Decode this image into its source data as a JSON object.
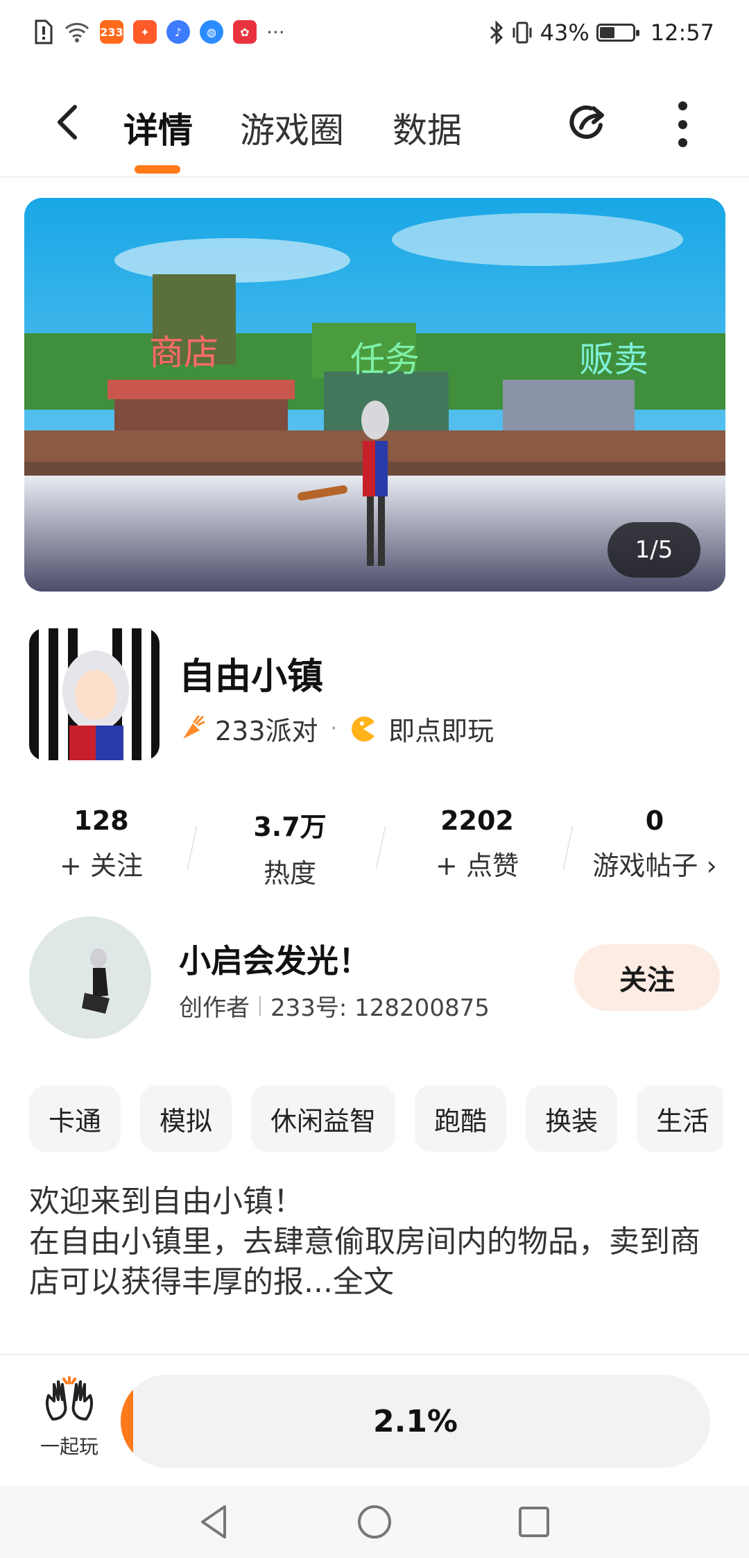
{
  "status_bar": {
    "icons": [
      "alert-icon",
      "wifi-icon",
      "app-233-icon",
      "app-party-icon",
      "music-icon",
      "browser-icon",
      "huawei-icon",
      "more-icon"
    ],
    "app_233": "233",
    "battery": "43%",
    "battery_level": 0.43,
    "time": "12:57"
  },
  "nav": {
    "tabs": [
      "详情",
      "游戏圈",
      "数据"
    ],
    "active_tab": "详情"
  },
  "banner": {
    "counter": "1/5",
    "scene_signs": [
      "商店",
      "任务",
      "贩卖"
    ]
  },
  "game": {
    "title": "自由小镇",
    "platform": "233派对",
    "dot": "·",
    "play_mode": "即点即玩"
  },
  "stats": [
    {
      "value": "128",
      "label": "+ 关注"
    },
    {
      "value": "3.7万",
      "label": "热度"
    },
    {
      "value": "2202",
      "label": "+ 点赞"
    },
    {
      "value": "0",
      "label": "游戏帖子 ›"
    }
  ],
  "author": {
    "name": "小启会发光！",
    "role": "创作者",
    "id_text": "233号: 128200875",
    "follow_label": "关注"
  },
  "tags": [
    "卡通",
    "模拟",
    "休闲益智",
    "跑酷",
    "换装",
    "生活"
  ],
  "description": {
    "line1": "欢迎来到自由小镇！",
    "line2": "在自由小镇里，去肆意偷取房间内的物品，卖到商店可以获得丰厚的报",
    "more": "...全文"
  },
  "action_bar": {
    "play_together_label": "一起玩",
    "progress_text": "2.1%",
    "progress_value": 0.021
  },
  "colors": {
    "accent": "#ff7a1a",
    "follow_bg": "#fdece4",
    "tag_bg": "#f4f5f7"
  }
}
